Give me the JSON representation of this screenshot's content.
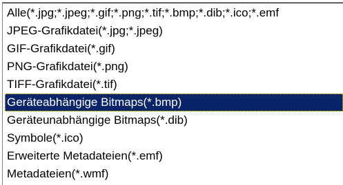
{
  "file_type_list": {
    "items": [
      {
        "label": "Alle(*.jpg;*.jpeg;*.gif;*.png;*.tif;*.bmp;*.dib;*.ico;*.emf",
        "selected": false
      },
      {
        "label": "JPEG-Grafikdatei(*.jpg;*.jpeg)",
        "selected": false
      },
      {
        "label": "GIF-Grafikdatei(*.gif)",
        "selected": false
      },
      {
        "label": "PNG-Grafikdatei(*.png)",
        "selected": false
      },
      {
        "label": "TIFF-Grafikdatei(*.tif)",
        "selected": false
      },
      {
        "label": "Geräteabhängige Bitmaps(*.bmp)",
        "selected": true
      },
      {
        "label": "Geräteunabhängige Bitmaps(*.dib)",
        "selected": false
      },
      {
        "label": "Symbole(*.ico)",
        "selected": false
      },
      {
        "label": "Erweiterte Metadateien(*.emf)",
        "selected": false
      },
      {
        "label": "Metadateien(*.wmf)",
        "selected": false
      }
    ]
  },
  "colors": {
    "selection_bg": "#0a246a",
    "selection_fg": "#ffffff"
  }
}
